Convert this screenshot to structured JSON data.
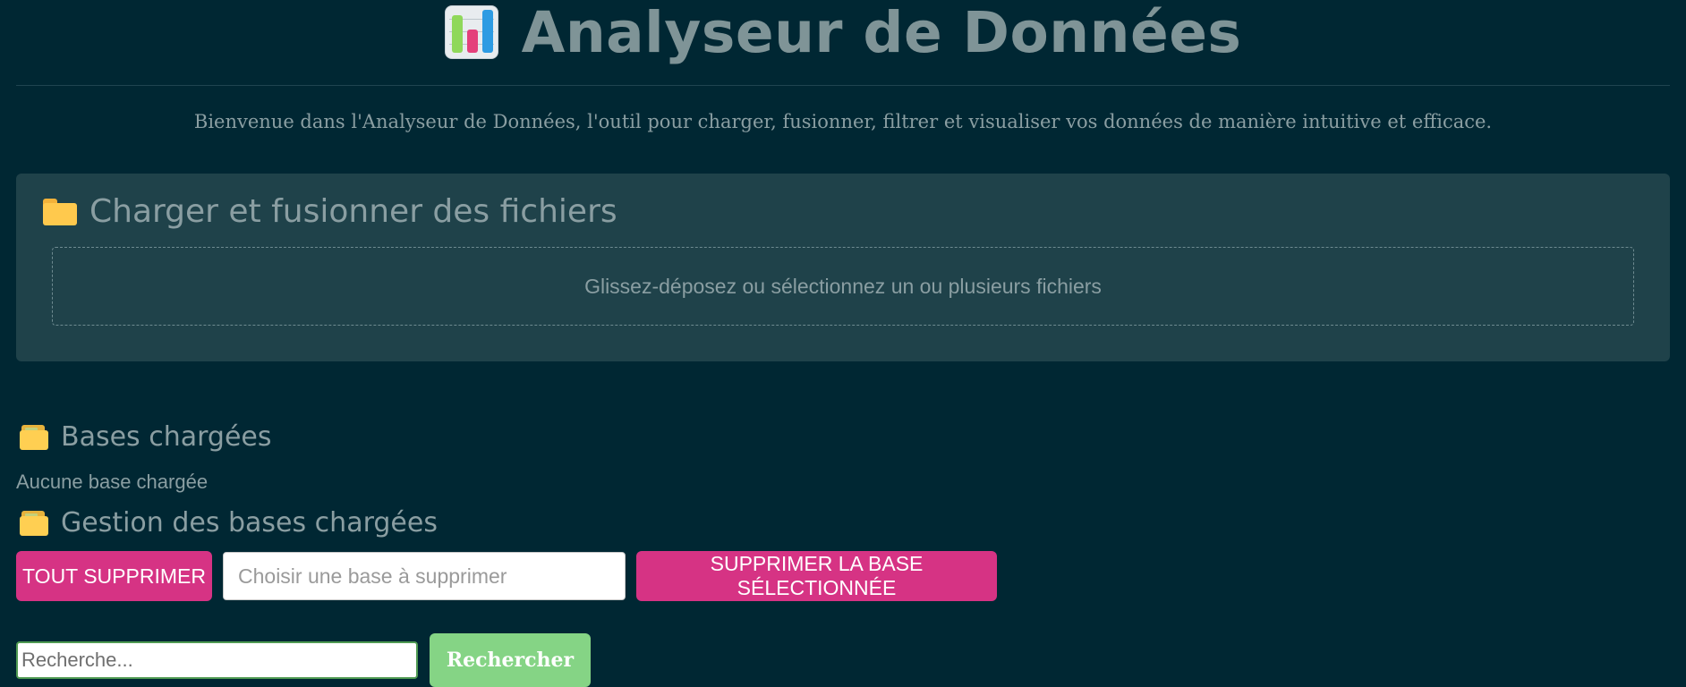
{
  "header": {
    "title": "Analyseur de Données",
    "icon": "bar-chart-icon"
  },
  "intro": {
    "text": "Bienvenue dans l'Analyseur de Données, l'outil pour charger, fusionner, filtrer et visualiser vos données de manière intuitive et efficace."
  },
  "upload": {
    "title": "Charger et fusionner des fichiers",
    "icon": "folder-icon",
    "dropzone_text": "Glissez-déposez ou sélectionnez un ou plusieurs fichiers"
  },
  "bases": {
    "title": "Bases chargées",
    "icon": "card-index-folder-icon",
    "empty_text": "Aucune base chargée"
  },
  "management": {
    "title": "Gestion des bases chargées",
    "icon": "card-index-folder-icon",
    "delete_all_label": "TOUT SUPPRIMER",
    "select_placeholder": "Choisir une base à supprimer",
    "delete_selected_label": "SUPPRIMER LA BASE SÉLECTIONNÉE"
  },
  "search": {
    "placeholder": "Recherche...",
    "button_label": "Rechercher"
  },
  "colors": {
    "background": "#002733",
    "panel": "#1f424a",
    "danger_button": "#d63384",
    "search_button": "#85d485",
    "text": "#8a9ea2"
  }
}
